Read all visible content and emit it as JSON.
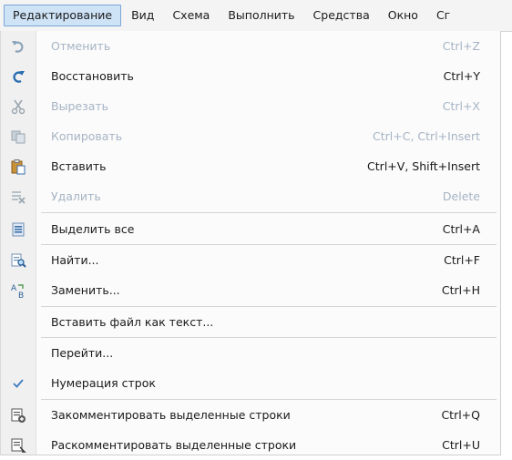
{
  "menubar": {
    "items": [
      "Редактирование",
      "Вид",
      "Схема",
      "Выполнить",
      "Средства",
      "Окно",
      "Сг"
    ]
  },
  "menu": {
    "items": [
      {
        "label": "Отменить",
        "shortcut": "Ctrl+Z",
        "icon": "undo-icon",
        "enabled": false
      },
      {
        "label": "Восстановить",
        "shortcut": "Ctrl+Y",
        "icon": "redo-icon",
        "enabled": true
      },
      {
        "label": "Вырезать",
        "shortcut": "Ctrl+X",
        "icon": "scissors-icon",
        "enabled": false
      },
      {
        "label": "Копировать",
        "shortcut": "Ctrl+C, Ctrl+Insert",
        "icon": "copy-icon",
        "enabled": false
      },
      {
        "label": "Вставить",
        "shortcut": "Ctrl+V, Shift+Insert",
        "icon": "paste-icon",
        "enabled": true
      },
      {
        "label": "Удалить",
        "shortcut": "Delete",
        "icon": "delete-icon",
        "enabled": false
      },
      {
        "label": "Выделить все",
        "shortcut": "Ctrl+A",
        "icon": "select-all-icon",
        "enabled": true
      },
      {
        "label": "Найти...",
        "shortcut": "Ctrl+F",
        "icon": "find-icon",
        "enabled": true
      },
      {
        "label": "Заменить...",
        "shortcut": "Ctrl+H",
        "icon": "replace-icon",
        "enabled": true
      },
      {
        "label": "Вставить файл как текст...",
        "shortcut": "",
        "icon": "",
        "enabled": true
      },
      {
        "label": "Перейти...",
        "shortcut": "",
        "icon": "",
        "enabled": true
      },
      {
        "label": "Нумерация строк",
        "shortcut": "",
        "icon": "checkmark-icon",
        "enabled": true
      },
      {
        "label": "Закомментировать выделенные строки",
        "shortcut": "Ctrl+Q",
        "icon": "comment-icon",
        "enabled": true
      },
      {
        "label": "Раскомментировать выделенные строки",
        "shortcut": "Ctrl+U",
        "icon": "uncomment-icon",
        "enabled": true
      }
    ]
  }
}
